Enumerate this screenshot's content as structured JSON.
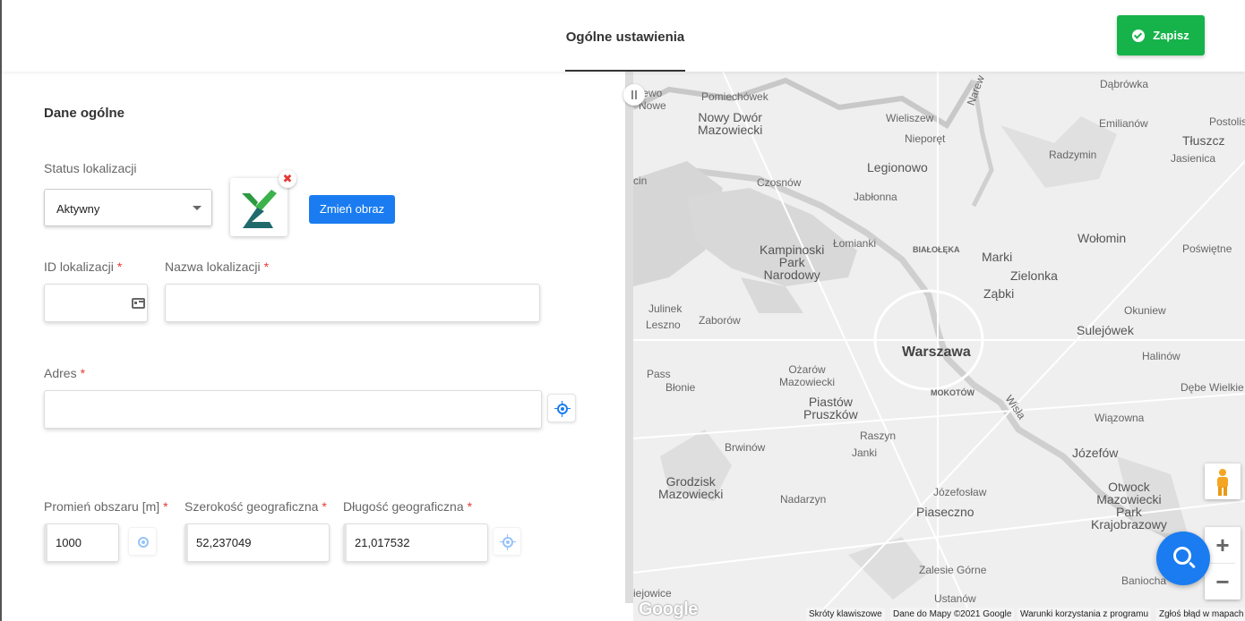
{
  "header": {
    "tab_label": "Ogólne ustawienia",
    "save_label": "Zapisz",
    "save_color": "#16b34a"
  },
  "form": {
    "section_title": "Dane ogólne",
    "status": {
      "label": "Status lokalizacji",
      "value": "Aktywny"
    },
    "change_image_label": "Zmień obraz",
    "remove_image_symbol": "✖",
    "location_id": {
      "label": "ID lokalizacji",
      "required_mark": "*",
      "value": ""
    },
    "location_name": {
      "label": "Nazwa lokalizacji",
      "required_mark": "*",
      "value": ""
    },
    "address": {
      "label": "Adres",
      "required_mark": "*",
      "value": ""
    },
    "radius": {
      "label": "Promień obszaru [m]",
      "required_mark": "*",
      "value": "1000"
    },
    "latitude": {
      "label": "Szerokość geograficzna",
      "required_mark": "*",
      "value": "52,237049"
    },
    "longitude": {
      "label": "Długość geograficzna",
      "required_mark": "*",
      "value": "21,017532"
    },
    "accent_color": "#1a7cf0"
  },
  "map": {
    "places": [
      {
        "name": "Dąbrówka",
        "cls": ""
      },
      {
        "name": "Pomiechówek",
        "cls": ""
      },
      {
        "name": "Nowy Dwór\nMazowiecki",
        "cls": "big"
      },
      {
        "name": "Wieliszew",
        "cls": ""
      },
      {
        "name": "Nieporęt",
        "cls": ""
      },
      {
        "name": "Emilianów",
        "cls": ""
      },
      {
        "name": "Postoliska",
        "cls": ""
      },
      {
        "name": "Tłuszcz",
        "cls": "big"
      },
      {
        "name": "Radzymin",
        "cls": ""
      },
      {
        "name": "Jasienica",
        "cls": ""
      },
      {
        "name": "Legionowo",
        "cls": "big"
      },
      {
        "name": "Czosnów",
        "cls": ""
      },
      {
        "name": "Jabłonna",
        "cls": ""
      },
      {
        "name": "Kampinoski\nPark\nNarodowy",
        "cls": "big"
      },
      {
        "name": "Łomianki",
        "cls": ""
      },
      {
        "name": "BIAŁOŁĘKA",
        "cls": "small"
      },
      {
        "name": "Wołomin",
        "cls": "big"
      },
      {
        "name": "Poświętne",
        "cls": ""
      },
      {
        "name": "Marki",
        "cls": "big"
      },
      {
        "name": "Zielonka",
        "cls": "big"
      },
      {
        "name": "Ząbki",
        "cls": "big"
      },
      {
        "name": "Julinek",
        "cls": ""
      },
      {
        "name": "Zaborów",
        "cls": ""
      },
      {
        "name": "Leszno",
        "cls": ""
      },
      {
        "name": "Okuniew",
        "cls": ""
      },
      {
        "name": "Sulejówek",
        "cls": "big"
      },
      {
        "name": "Warszawa",
        "cls": "city"
      },
      {
        "name": "Halinów",
        "cls": ""
      },
      {
        "name": "Pass",
        "cls": ""
      },
      {
        "name": "Błonie",
        "cls": ""
      },
      {
        "name": "Ożarów\nMazowiecki",
        "cls": ""
      },
      {
        "name": "MOKOTÓW",
        "cls": "small"
      },
      {
        "name": "Dębe Wielkie",
        "cls": ""
      },
      {
        "name": "Piastów\nPruszków",
        "cls": "big"
      },
      {
        "name": "Wisła",
        "cls": ""
      },
      {
        "name": "Wiązowna",
        "cls": ""
      },
      {
        "name": "Raszyn",
        "cls": ""
      },
      {
        "name": "Brwinów",
        "cls": ""
      },
      {
        "name": "Janki",
        "cls": ""
      },
      {
        "name": "Józefów",
        "cls": "big"
      },
      {
        "name": "Grodzisk\nMazowiecki",
        "cls": "big"
      },
      {
        "name": "Józefosław",
        "cls": ""
      },
      {
        "name": "Otwock\nMazowiecki\nPark\nKrajobrazowy",
        "cls": "big"
      },
      {
        "name": "Nadarzyn",
        "cls": ""
      },
      {
        "name": "Piaseczno",
        "cls": "big"
      },
      {
        "name": "Zalesie Górne",
        "cls": ""
      },
      {
        "name": "Baniocha",
        "cls": ""
      },
      {
        "name": "Ustanów",
        "cls": ""
      },
      {
        "name": "Narew",
        "cls": ""
      },
      {
        "name": "ewo\nNowe",
        "cls": ""
      },
      {
        "name": "cin",
        "cls": ""
      },
      {
        "name": "iejowice",
        "cls": ""
      }
    ],
    "attribution": [
      "Skróty klawiszowe",
      "Dane do Mapy ©2021 Google",
      "Warunki korzystania z programu",
      "Zgłoś błąd w mapach"
    ],
    "google_logo": "Google",
    "zoom_in": "+",
    "zoom_out": "−"
  }
}
